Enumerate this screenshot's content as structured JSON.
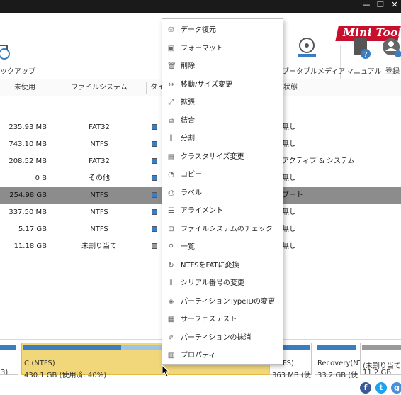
{
  "window": {
    "minimize_glyph": "—",
    "restore_glyph": "❐",
    "close_glyph": "✕"
  },
  "brand": {
    "logo_text": "Mini Tool"
  },
  "toolbar": {
    "backup_label": "ックアップ",
    "bootable_media_label": "ブータブルメディア",
    "manual_label": "マニュアル",
    "register_label": "登録"
  },
  "table": {
    "columns": [
      "未使用",
      "ファイルシステム",
      "タイ",
      "状態"
    ],
    "rows": [
      {
        "unused": "235.93 MB",
        "fs": "FAT32",
        "status": "無し",
        "type_color": "#3a7dc0"
      },
      {
        "unused": "743.10 MB",
        "fs": "NTFS",
        "status": "無し",
        "type_color": "#3a7dc0"
      },
      {
        "unused": "208.52 MB",
        "fs": "FAT32",
        "status": "アクティブ & システム",
        "type_color": "#3a7dc0"
      },
      {
        "unused": "0 B",
        "fs": "その他",
        "status": "無し",
        "type_color": "#3a7dc0"
      },
      {
        "unused": "254.98 GB",
        "fs": "NTFS",
        "status": "ブート",
        "type_color": "#3a7dc0",
        "selected": true
      },
      {
        "unused": "337.50 MB",
        "fs": "NTFS",
        "status": "無し",
        "type_color": "#3a7dc0"
      },
      {
        "unused": "5.17 GB",
        "fs": "NTFS",
        "status": "無し",
        "type_color": "#3a7dc0"
      },
      {
        "unused": "11.18 GB",
        "fs": "未割り当て",
        "status": "無し",
        "type_color": "#9a9a9a"
      }
    ]
  },
  "context_menu": {
    "items": [
      {
        "label": "データ復元",
        "icon": "recover-icon"
      },
      {
        "label": "フォーマット",
        "icon": "format-icon"
      },
      {
        "label": "削除",
        "icon": "trash-icon"
      },
      {
        "label": "移動/サイズ変更",
        "icon": "resize-icon"
      },
      {
        "label": "拡張",
        "icon": "extend-icon"
      },
      {
        "label": "結合",
        "icon": "merge-icon"
      },
      {
        "label": "分割",
        "icon": "split-icon"
      },
      {
        "label": "クラスタサイズ変更",
        "icon": "cluster-icon"
      },
      {
        "label": "コピー",
        "icon": "copy-icon"
      },
      {
        "label": "ラベル",
        "icon": "label-icon"
      },
      {
        "label": "アライメント",
        "icon": "align-icon"
      },
      {
        "label": "ファイルシステムのチェック",
        "icon": "check-fs-icon"
      },
      {
        "label": "一覧",
        "icon": "explore-icon"
      },
      {
        "label": "NTFSをFATに変換",
        "icon": "convert-icon"
      },
      {
        "label": "シリアル番号の変更",
        "icon": "serial-icon"
      },
      {
        "label": "パーティションTypeIDの変更",
        "icon": "typeid-icon"
      },
      {
        "label": "サーフェステスト",
        "icon": "surface-test-icon"
      },
      {
        "label": "パーティションの抹消",
        "icon": "wipe-icon"
      },
      {
        "label": "プロパティ",
        "icon": "properties-icon"
      }
    ]
  },
  "disk_map": {
    "partitions": [
      {
        "name": "",
        "size": "3)",
        "bar_color": "#3a7dc0"
      },
      {
        "name": "C:(NTFS)",
        "size": "430.1 GB (使用済: 40%)",
        "bar_color": "#3a7dc0",
        "used_fraction": 0.4
      },
      {
        "name": "FS)",
        "size": "363 MB (使",
        "bar_color": "#3a7dc0"
      },
      {
        "name": "Recovery(NT",
        "size": "33.2 GB (使",
        "bar_color": "#3a7dc0"
      },
      {
        "name": "(未割り当て)",
        "size": "11.2 GB",
        "bar_color": "#9a9a9a"
      }
    ]
  },
  "footer": {
    "facebook_glyph": "f",
    "twitter_glyph": "t",
    "google_glyph": "g"
  },
  "colors": {
    "accent": "#3a7dc0",
    "brand_red": "#c8102e",
    "selected_row": "#8c8c8c",
    "c_drive": "#f2d77a"
  }
}
